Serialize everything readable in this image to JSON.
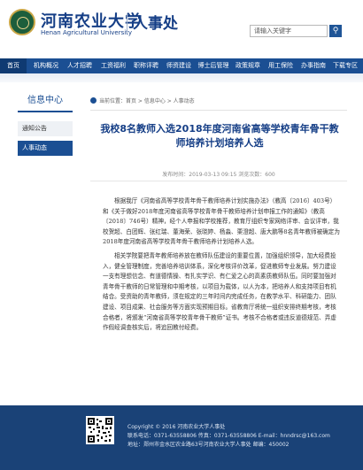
{
  "header": {
    "logo_cn": "河南农业大学",
    "logo_en": "Henan Agricultural University",
    "site_name": "人事处",
    "search_placeholder": "请输入关键字",
    "search_button_icon": "search-icon"
  },
  "nav": {
    "items": [
      "首页",
      "机构概况",
      "人才招聘",
      "工资福利",
      "职称评聘",
      "师资建设",
      "博士后管理",
      "政策规章",
      "用工保险",
      "办事指南",
      "下载专区"
    ],
    "active": "首页"
  },
  "sidebar": {
    "title": "信息中心",
    "items": [
      "通知公告",
      "人事动态"
    ],
    "active": "人事动态"
  },
  "breadcrumb": {
    "icon": "location-pin-icon",
    "text": "当前位置：首页 > 信息中心 > 人事动态"
  },
  "article": {
    "title": "我校8名教师入选2018年度河南省高等学校青年骨干教师培养计划培养人选",
    "meta": "发布时间：2019-03-13 09:15   浏览次数：600",
    "paragraphs": [
      "根据我厅《河南省高等学校青年骨干教师培养计划实施办法》（教高〔2016〕403号）和《关于做好2018年度河南省高等学校青年骨干教师培养计划申报工作的通知》（教高〔2018〕746号）精神，经个人申报和学校推荐，教育厅组织专家网络评审、会议评审，我校贺超、白团辉、张红瑞、董海荣、张晓婷、杨淼、栗澄超、唐大鹏等8名青年教师被确定为2018年度河南省高等学校青年骨干教师培养计划培养人选。",
      "相关学院要把青年教师培养放在教师队伍建设的重要位置，加强组织领导，加大经费投入，健全管理制度，完善培养培训体系，深化考核评价改革，促进教师专业发展。努力建设一支有理想信念、有道德情操、有扎实学识、有仁爱之心的高素质教师队伍。同时要加强对青年骨干教师的日常管理和中期考核，以项目为载体，以人为本，把培养人和支持项目有机结合。受资助的青年教师，须在规定的三年时间内完成任务，在教学水平、科研能力、团队建设、项目成果、社会服务等方面实现预期目标。省教育厅将统一组织安排终期考核，考核合格者，将颁发“河南省高等学校青年骨干教师”证书。考核不合格者或违反道德规范、弄虚作假经调查核实后，将追回教付经费。"
    ]
  },
  "footer": {
    "lines": [
      "Copyright © 2016  河南农业大学人事处",
      "联系电话：0371-63558806    传真：0371-63558806    E-mail：hnndrsc@163.com",
      "地址：郑州市金水区农业路63号河南农业大学人事处    邮编：450002"
    ]
  },
  "colors": {
    "primary": "#1b4f93",
    "title": "#153e86",
    "footer": "#1a4277"
  }
}
